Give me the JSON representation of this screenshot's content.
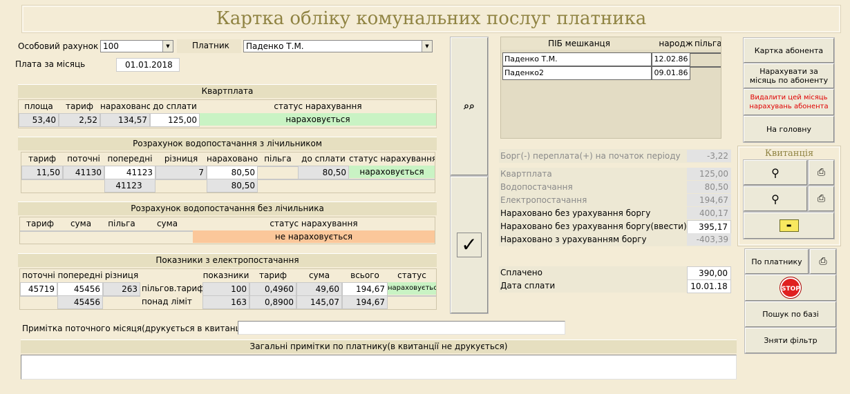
{
  "title": "Картка обліку комунальних послуг платника",
  "header": {
    "account_label": "Особовий рахунок",
    "account_value": "100",
    "payer_label": "Платник",
    "payer_value": "Паденко Т.М.",
    "month_label": "Плата за місяць",
    "month_value": "01.01.2018"
  },
  "kvartplata": {
    "title": "Квартплата",
    "headers": [
      "площа",
      "тариф",
      "нараховано",
      "до сплати",
      "статус нарахування"
    ],
    "row": [
      "53,40",
      "2,52",
      "134,57",
      "125,00",
      "нараховується"
    ]
  },
  "water_meter": {
    "title": "Розрахунок водопостачання з лічильником",
    "headers": [
      "тариф",
      "поточні",
      "попередні",
      "різниця",
      "нараховано",
      "пільга",
      "до сплати",
      "статус нарахування"
    ],
    "row1": [
      "11,50",
      "41130",
      "41123",
      "7",
      "80,50",
      "",
      "80,50",
      "нараховується"
    ],
    "row2": [
      "",
      "",
      "41123",
      "",
      "80,50",
      "",
      "",
      ""
    ]
  },
  "water_nometer": {
    "title": "Розрахунок водопостачання без лічильника",
    "headers": [
      "тариф",
      "сума",
      "пільга",
      "сума",
      "статус нарахування"
    ],
    "status": "не нараховується"
  },
  "electro": {
    "title": "Показники з електропостачання",
    "headers": [
      "поточні",
      "попередні",
      "різниця",
      "",
      "показники",
      "тариф",
      "сума",
      "всього",
      "статус"
    ],
    "row1": [
      "45719",
      "45456",
      "263",
      "пільгов.тариф",
      "100",
      "0,4960",
      "49,60",
      "194,67",
      "нараховується"
    ],
    "row2": [
      "",
      "45456",
      "",
      "понад ліміт",
      "163",
      "0,8900",
      "145,07",
      "194,67",
      ""
    ]
  },
  "note_month_label": "Примітка поточного місяця(друкується в квитанції)",
  "note_month_value": "",
  "general_notes_label": "Загальні примітки по платнику(в квитанції не друкується)",
  "general_notes_value": "",
  "residents": {
    "headers": [
      "ПІБ мешканця",
      "народж",
      "пільга"
    ],
    "rows": [
      {
        "name": "Паденко Т.М.",
        "born": "12.02.86",
        "benefit": ""
      },
      {
        "name": "Паденко2",
        "born": "09.01.86",
        "benefit": ""
      }
    ]
  },
  "summary": {
    "debt_label": "Борг(-) переплата(+) на початок періоду",
    "debt_value": "-3,22",
    "kvartplata_label": "Квартплата",
    "kvartplata_value": "125,00",
    "water_label": "Водопостачання",
    "water_value": "80,50",
    "electro_label": "Електропостачання",
    "electro_value": "194,67",
    "charged_nodebt_label": "Нараховано без урахування боргу",
    "charged_nodebt_value": "400,17",
    "charged_nodebt_input_label": "Нараховано без урахування боргу(ввести)",
    "charged_nodebt_input_value": "395,17",
    "charged_debt_label": "Нараховано з урахуванням боргу",
    "charged_debt_value": "-403,39",
    "paid_label": "Сплачено",
    "paid_value": "390,00",
    "paid_date_label": "Дата сплати",
    "paid_date_value": "10.01.18"
  },
  "buttons": {
    "card": "Картка абонента",
    "charge_month": "Нарахувати за місяць по абоненту",
    "delete_month": "Видалити цей місяць нарахувань абонента",
    "home": "На головну",
    "receipt_title": "Квитанція",
    "by_payer": "По платнику",
    "stop": "STOP",
    "db_search": "Пошук по базі",
    "remove_filter": "Зняти фільтр"
  },
  "colors": {
    "background": "#f4ecd6",
    "title_text": "#8f8342",
    "status_active": "#c9f3c4",
    "status_inactive": "#fbc79a",
    "delete_text": "#e00000",
    "stop_red": "#e02020"
  }
}
